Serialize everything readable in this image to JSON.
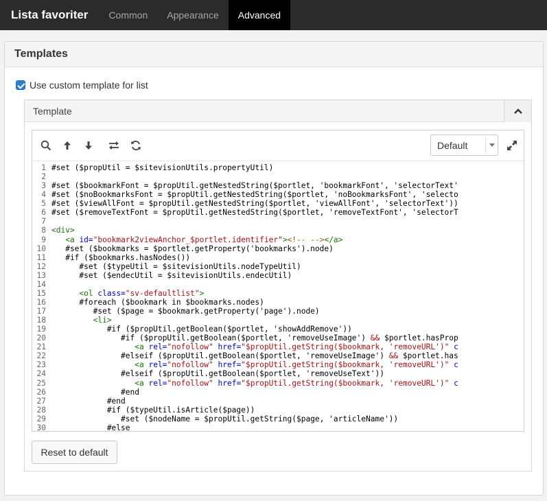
{
  "app": {
    "title": "Lista favoriter",
    "tabs": [
      {
        "label": "Common",
        "active": false
      },
      {
        "label": "Appearance",
        "active": false
      },
      {
        "label": "Advanced",
        "active": true
      }
    ]
  },
  "panel": {
    "title": "Templates",
    "checkbox_label": "Use custom template for list",
    "checkbox_checked": true,
    "accordion_title": "Template",
    "editor": {
      "toolbar_icons": [
        "search-icon",
        "arrow-up-icon",
        "arrow-down-icon",
        "swap-icon",
        "refresh-icon"
      ],
      "theme_select_value": "Default",
      "fullscreen_icon": "expand-icon",
      "lines": [
        {
          "n": "1",
          "segs": [
            [
              "",
              "#set ($propUtil = $sitevisionUtils.propertyUtil)"
            ]
          ]
        },
        {
          "n": "2",
          "segs": [
            [
              "",
              ""
            ]
          ]
        },
        {
          "n": "3",
          "segs": [
            [
              "",
              "#set ($bookmarkFont = $propUtil.getNestedString($portlet, 'bookmarkFont', 'selectorText'"
            ]
          ]
        },
        {
          "n": "4",
          "segs": [
            [
              "",
              "#set ($noBookmarksFont = $propUtil.getNestedString($portlet, 'noBookmarksFont', 'selecto"
            ]
          ]
        },
        {
          "n": "5",
          "segs": [
            [
              "",
              "#set ($viewAllFont = $propUtil.getNestedString($portlet, 'viewAllFont', 'selectorText'))"
            ]
          ]
        },
        {
          "n": "6",
          "segs": [
            [
              "",
              "#set ($removeTextFont = $propUtil.getNestedString($portlet, 'removeTextFont', 'selectorT"
            ]
          ]
        },
        {
          "n": "7",
          "segs": [
            [
              "",
              ""
            ]
          ]
        },
        {
          "n": "8",
          "segs": [
            [
              "tag",
              "<div>"
            ]
          ]
        },
        {
          "n": "9",
          "segs": [
            [
              "",
              "   "
            ],
            [
              "tag",
              "<a "
            ],
            [
              "attr",
              "id="
            ],
            [
              "str",
              "\"bookmark2viewAnchor_$portlet.identifier\""
            ],
            [
              "tag",
              ">"
            ],
            [
              "com",
              "<!-- -->"
            ],
            [
              "tag",
              "</a>"
            ]
          ]
        },
        {
          "n": "10",
          "segs": [
            [
              "",
              "   #set ($bookmarks = $portlet.getProperty('bookmarks').node)"
            ]
          ]
        },
        {
          "n": "11",
          "segs": [
            [
              "",
              "   #if ($bookmarks.hasNodes())"
            ]
          ]
        },
        {
          "n": "12",
          "segs": [
            [
              "",
              "      #set ($typeUtil = $sitevisionUtils.nodeTypeUtil)"
            ]
          ]
        },
        {
          "n": "13",
          "segs": [
            [
              "",
              "      #set ($endecUtil = $sitevisionUtils.endecUtil)"
            ]
          ]
        },
        {
          "n": "14",
          "segs": [
            [
              "",
              ""
            ]
          ]
        },
        {
          "n": "15",
          "segs": [
            [
              "",
              "      "
            ],
            [
              "tag",
              "<ol "
            ],
            [
              "attr",
              "class="
            ],
            [
              "str",
              "\"sv-defaultlist\""
            ],
            [
              "tag",
              ">"
            ]
          ]
        },
        {
          "n": "16",
          "segs": [
            [
              "",
              "      #foreach ($bookmark in $bookmarks.nodes)"
            ]
          ]
        },
        {
          "n": "17",
          "segs": [
            [
              "",
              "         #set ($page = $bookmark.getProperty('page').node)"
            ]
          ]
        },
        {
          "n": "18",
          "segs": [
            [
              "",
              "         "
            ],
            [
              "tag",
              "<li>"
            ]
          ]
        },
        {
          "n": "19",
          "segs": [
            [
              "",
              "            #if ($propUtil.getBoolean($portlet, 'showAddRemove'))"
            ]
          ]
        },
        {
          "n": "20",
          "segs": [
            [
              "",
              "               #if ($propUtil.getBoolean($portlet, 'removeUseImage') "
            ],
            [
              "str",
              "&&"
            ],
            [
              "",
              " $portlet.hasProp"
            ]
          ]
        },
        {
          "n": "21",
          "segs": [
            [
              "",
              "                  "
            ],
            [
              "tag",
              "<a "
            ],
            [
              "attr",
              "rel="
            ],
            [
              "str",
              "\"nofollow\""
            ],
            [
              "",
              " "
            ],
            [
              "attr",
              "href="
            ],
            [
              "str",
              "\"$propUtil.getString($bookmark, 'removeURL')\""
            ],
            [
              "",
              " "
            ],
            [
              "attr",
              "c"
            ]
          ]
        },
        {
          "n": "22",
          "segs": [
            [
              "",
              "               #elseif ($propUtil.getBoolean($portlet, 'removeUseImage') "
            ],
            [
              "str",
              "&&"
            ],
            [
              "",
              " $portlet.has"
            ]
          ]
        },
        {
          "n": "23",
          "segs": [
            [
              "",
              "                  "
            ],
            [
              "tag",
              "<a "
            ],
            [
              "attr",
              "rel="
            ],
            [
              "str",
              "\"nofollow\""
            ],
            [
              "",
              " "
            ],
            [
              "attr",
              "href="
            ],
            [
              "str",
              "\"$propUtil.getString($bookmark, 'removeURL')\""
            ],
            [
              "",
              " "
            ],
            [
              "attr",
              "c"
            ]
          ]
        },
        {
          "n": "24",
          "segs": [
            [
              "",
              "               #elseif ($propUtil.getBoolean($portlet, 'removeUseText'))"
            ]
          ]
        },
        {
          "n": "25",
          "segs": [
            [
              "",
              "                  "
            ],
            [
              "tag",
              "<a "
            ],
            [
              "attr",
              "rel="
            ],
            [
              "str",
              "\"nofollow\""
            ],
            [
              "",
              " "
            ],
            [
              "attr",
              "href="
            ],
            [
              "str",
              "\"$propUtil.getString($bookmark, 'removeURL')\""
            ],
            [
              "",
              " "
            ],
            [
              "attr",
              "c"
            ]
          ]
        },
        {
          "n": "26",
          "segs": [
            [
              "",
              "               #end"
            ]
          ]
        },
        {
          "n": "27",
          "segs": [
            [
              "",
              "            #end"
            ]
          ]
        },
        {
          "n": "28",
          "segs": [
            [
              "",
              "            #if ($typeUtil.isArticle($page))"
            ]
          ]
        },
        {
          "n": "29",
          "segs": [
            [
              "",
              "               #set ($nodeName = $propUtil.getString($page, 'articleName'))"
            ]
          ]
        },
        {
          "n": "30",
          "segs": [
            [
              "",
              "            #else"
            ]
          ]
        }
      ]
    },
    "reset_button": "Reset to default"
  },
  "colors": {
    "topbar": "#2b2b2b",
    "active_tab": "#000000",
    "checkbox": "#2d7fd2",
    "code_tag": "#117700",
    "code_attr": "#0000cc",
    "code_string": "#aa1111",
    "code_comment": "#aa5500"
  }
}
